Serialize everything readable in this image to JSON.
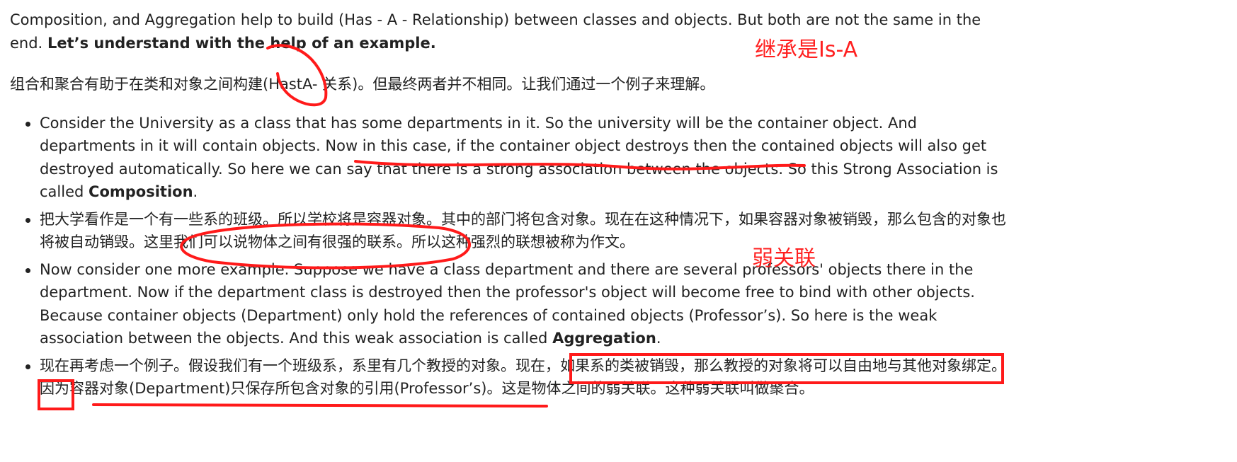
{
  "intro": {
    "line_en": "Composition, and Aggregation help to build (Has - A - Relationship) between classes and objects. But both are not the same in the end.",
    "line_en_bold": "Let’s understand with the help of an example.",
    "line_cn": "组合和聚合有助于在类和对象之间构建(HastA- 关系)。但最终两者并不相同。让我们通过一个例子来理解。"
  },
  "bullets": [
    {
      "text": "Consider the University as a class that has some departments in it. So the university will be the container object. And departments in it will contain objects. Now in this case, if the container object destroys then the contained objects will also get destroyed automatically.  So here we can say that there is a strong association between the objects. So this Strong Association is called",
      "bold": "Composition",
      "tail": "."
    },
    {
      "text": "把大学看作是一个有一些系的班级。所以学校将是容器对象。其中的部门将包含对象。现在在这种情况下，如果容器对象被销毁，那么包含的对象也将被自动销毁。这里我们可以说物体之间有很强的联系。所以这种强烈的联想被称为作文。",
      "bold": "",
      "tail": ""
    },
    {
      "text": "Now consider one more example. Suppose we have a class department and there are several professors' objects there in the department. Now if the department class is destroyed then the professor's object will become free to bind with other objects. Because container objects (Department) only hold the references of contained objects (Professor’s). So here is the weak association between the objects. And this weak association is called",
      "bold": "Aggregation",
      "tail": "."
    },
    {
      "text": "现在再考虑一个例子。假设我们有一个班级系，系里有几个教授的对象。现在，如果系的类被销毁，那么教授的对象将可以自由地与其他对象绑定。因为容器对象(Department)只保存所包含对象的引用(Professor’s)。这是物体之间的弱关联。这种弱关联叫做聚合。",
      "bold": "",
      "tail": ""
    }
  ],
  "annotations": {
    "is_a_note": "继承是Is-A",
    "weak_note": "弱关联",
    "ink_color": "#ff1a1a"
  }
}
